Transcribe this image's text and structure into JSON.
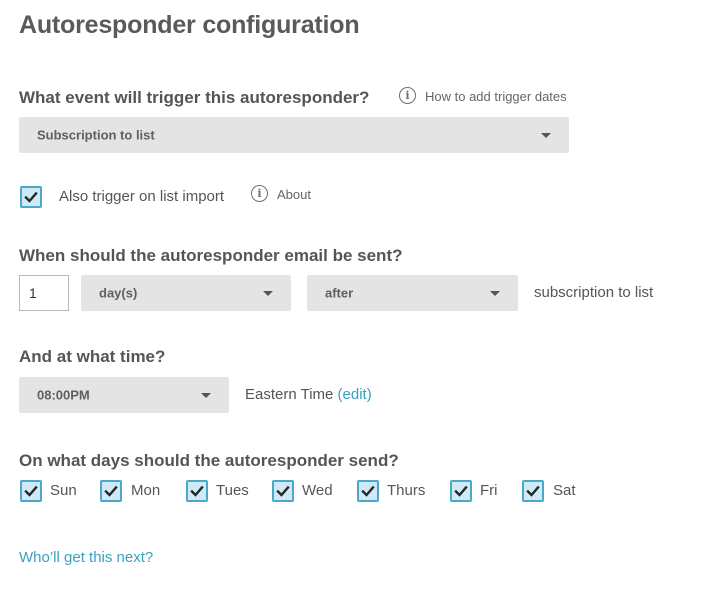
{
  "page": {
    "title": "Autoresponder configuration"
  },
  "trigger": {
    "heading": "What event will trigger this autoresponder?",
    "help_link": "How to add trigger dates",
    "event_selected": "Subscription to list",
    "also_import_label": "Also trigger on list import",
    "also_import_checked": true,
    "about_link": "About"
  },
  "timing": {
    "heading": "When should the autoresponder email be sent?",
    "amount": "1",
    "unit_selected": "day(s)",
    "relation_selected": "after",
    "suffix": "subscription to list"
  },
  "time": {
    "heading": "And at what time?",
    "time_selected": "08:00PM",
    "timezone": "Eastern Time",
    "edit_link": "(edit)"
  },
  "days": {
    "heading": "On what days should the autoresponder send?",
    "items": [
      {
        "label": "Sun",
        "checked": true
      },
      {
        "label": "Mon",
        "checked": true
      },
      {
        "label": "Tues",
        "checked": true
      },
      {
        "label": "Wed",
        "checked": true
      },
      {
        "label": "Thurs",
        "checked": true
      },
      {
        "label": "Fri",
        "checked": true
      },
      {
        "label": "Sat",
        "checked": true
      }
    ]
  },
  "footer": {
    "next_link": "Who’ll get this next?"
  },
  "colors": {
    "accent": "#3aa0c0",
    "checkbox_border": "#4aa8c8",
    "checkbox_fill": "#cfeaf4",
    "select_bg": "#e4e4e4"
  }
}
